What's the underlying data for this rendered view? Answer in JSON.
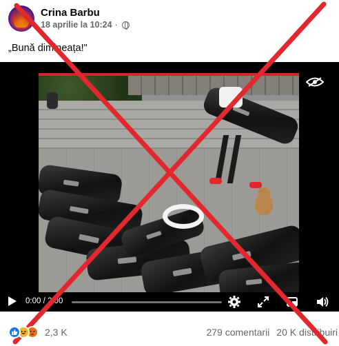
{
  "post": {
    "author": "Crina Barbu",
    "timestamp": "18 aprilie la 10:24",
    "privacy_icon": "globe-icon",
    "caption": "„Bună dimineața!\""
  },
  "video": {
    "timecode": "0:00 / 2:00",
    "progress": 0,
    "icons": [
      "play-icon",
      "eye-off-icon",
      "settings-icon",
      "expand-icon",
      "fullscreen-icon",
      "volume-icon"
    ]
  },
  "footer": {
    "reaction_icons": [
      "like-icon",
      "haha-icon",
      "angry-icon"
    ],
    "reaction_count": "2,3 K",
    "comments": "279 comentarii",
    "shares": "20 K distribuiri"
  },
  "overlay": {
    "mark": "cross-out",
    "color": "#e0282e"
  }
}
